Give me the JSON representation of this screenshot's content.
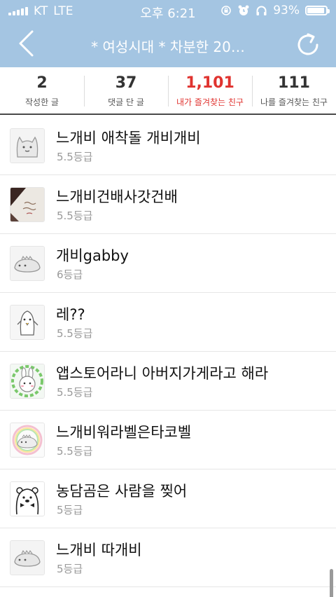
{
  "status_bar": {
    "carrier": "KT",
    "network": "LTE",
    "time": "오후 6:21",
    "battery_text": "93%",
    "battery_level": 0.93
  },
  "header": {
    "title": "* 여성시대 *  차분한 20…",
    "colors": {
      "bar": "#a4c5e2",
      "accent_red": "#e0332f"
    }
  },
  "stats": [
    {
      "value": "2",
      "label": "작성한 글",
      "active": false
    },
    {
      "value": "37",
      "label": "댓글 단 글",
      "active": false
    },
    {
      "value": "1,101",
      "label": "내가 즐겨찾는 친구",
      "active": true
    },
    {
      "value": "111",
      "label": "나를 즐겨찾는 친구",
      "active": false
    }
  ],
  "friends": [
    {
      "name": "느개비 애착돌 개비개비",
      "grade": "5.5등급",
      "avatar_icon": "cat-sticker-icon"
    },
    {
      "name": "느개비건배사갓건배",
      "grade": "5.5등급",
      "avatar_icon": "photo-thumbnail-icon"
    },
    {
      "name": "개비gabby",
      "grade": "6등급",
      "avatar_icon": "dino-sticker-icon"
    },
    {
      "name": "레??",
      "grade": "5.5등급",
      "avatar_icon": "penguin-sticker-icon"
    },
    {
      "name": "앱스토어라니 아버지가게라고 해라",
      "grade": "5.5등급",
      "avatar_icon": "bunny-sticker-icon"
    },
    {
      "name": "느개비워라벨은타코벨",
      "grade": "5.5등급",
      "avatar_icon": "rainbow-dino-icon"
    },
    {
      "name": "농담곰은 사람을 찢어",
      "grade": "5등급",
      "avatar_icon": "bear-sticker-icon"
    },
    {
      "name": "느개비 따개비",
      "grade": "5등급",
      "avatar_icon": "dino-sticker-icon"
    }
  ]
}
